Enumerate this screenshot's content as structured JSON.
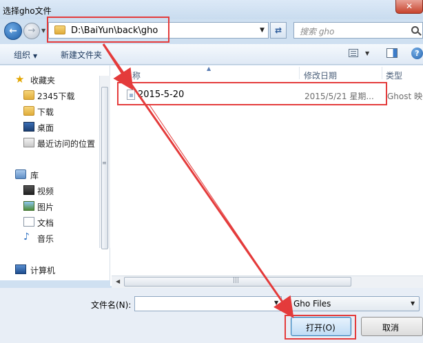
{
  "window": {
    "title": "选择gho文件"
  },
  "address": {
    "path": "D:\\BaiYun\\back\\gho",
    "search_placeholder": "搜索 gho"
  },
  "toolbar": {
    "organize": "组织",
    "new_folder": "新建文件夹"
  },
  "sidebar": {
    "favorites": "收藏夹",
    "items_fav": [
      "2345下载",
      "下载",
      "桌面",
      "最近访问的位置"
    ],
    "libraries": "库",
    "items_lib": [
      "视频",
      "图片",
      "文档",
      "音乐"
    ],
    "computer": "计算机"
  },
  "list": {
    "col_name": "名称",
    "col_date": "修改日期",
    "col_type": "类型",
    "files": [
      {
        "name": "2015-5-20",
        "date": "2015/5/21 星期...",
        "type": "Ghost 映像"
      }
    ]
  },
  "bottom": {
    "filename_label": "文件名(N):",
    "filename_value": "",
    "filter": "Gho Files",
    "open": "打开(O)",
    "cancel": "取消"
  },
  "colors": {
    "highlight": "#e43b3b",
    "accent": "#3c7fb1"
  }
}
